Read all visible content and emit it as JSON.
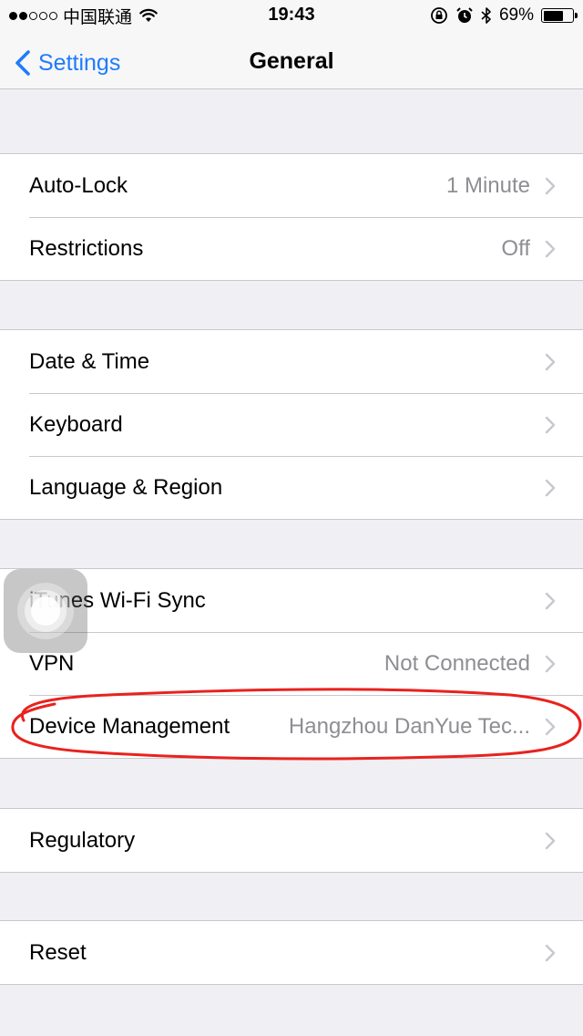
{
  "status_bar": {
    "carrier": "中国联通",
    "time": "19:43",
    "battery_percent": "69%",
    "battery_level": 0.69,
    "signal_bars_filled": 2,
    "signal_bars_total": 5
  },
  "nav": {
    "back_label": "Settings",
    "title": "General"
  },
  "groups": [
    {
      "rows": [
        {
          "label": "Auto-Lock",
          "value": "1 Minute"
        },
        {
          "label": "Restrictions",
          "value": "Off"
        }
      ]
    },
    {
      "rows": [
        {
          "label": "Date & Time",
          "value": ""
        },
        {
          "label": "Keyboard",
          "value": ""
        },
        {
          "label": "Language & Region",
          "value": ""
        }
      ]
    },
    {
      "rows": [
        {
          "label": "iTunes Wi-Fi Sync",
          "value": ""
        },
        {
          "label": "VPN",
          "value": "Not Connected"
        },
        {
          "label": "Device Management",
          "value": "Hangzhou DanYue Tec..."
        }
      ]
    },
    {
      "rows": [
        {
          "label": "Regulatory",
          "value": ""
        }
      ]
    },
    {
      "rows": [
        {
          "label": "Reset",
          "value": ""
        }
      ]
    }
  ],
  "colors": {
    "accent": "#1f7cfb",
    "background": "#efeff4",
    "annotation": "#e8221e",
    "secondary_text": "#8e8e93"
  }
}
